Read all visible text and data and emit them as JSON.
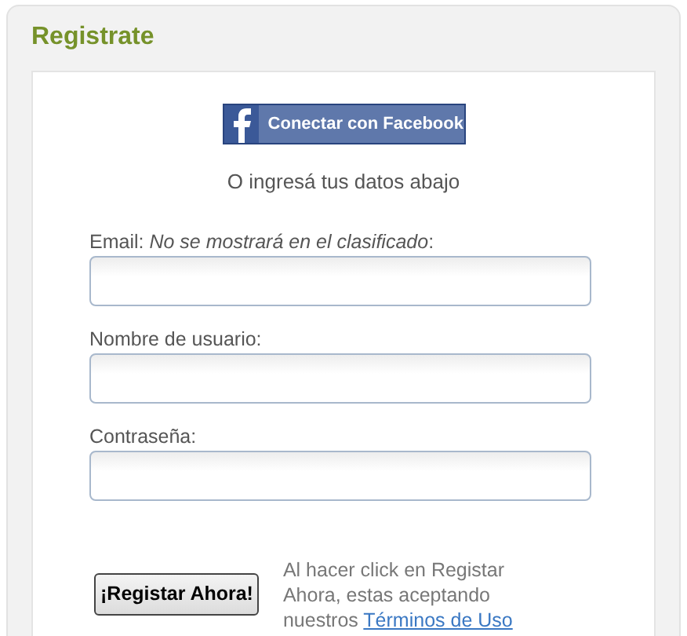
{
  "panel": {
    "title": "Registrate"
  },
  "facebook_button": {
    "label": "Conectar con Facebook"
  },
  "divider_text": "O ingresá tus datos abajo",
  "fields": [
    {
      "label": "Email: ",
      "note": "No se mostrará en el clasificado",
      "label_end": ":"
    },
    {
      "label": "Nombre de usuario:"
    },
    {
      "label": "Contraseña:"
    }
  ],
  "submit_button": {
    "label": "¡Registar Ahora!"
  },
  "terms": {
    "text": "Al hacer click en Registar Ahora, estas aceptando nuestros ",
    "link": "Términos de Uso"
  }
}
